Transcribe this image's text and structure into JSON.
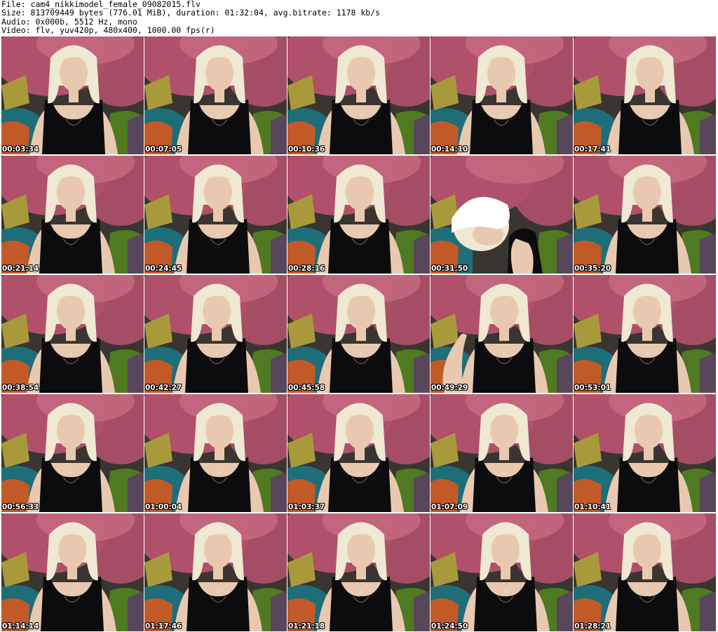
{
  "header": {
    "file_line": "File: cam4_nikkimodel_female_09082015.flv",
    "size_line": "Size: 813709449 bytes (776.01 MiB), duration: 01:32:04, avg.bitrate: 1178 kb/s",
    "audio_line": "Audio: 0x000b, 5512 Hz, mono",
    "video_line": "Video: flv, yuv420p, 480x400, 1000.00 fps(r)"
  },
  "colors": {
    "background": "#ffffff",
    "flower_pink": "#b0506a",
    "wall_dark": "#3a3530",
    "teal_fabric": "#1e6e7a",
    "green_fabric": "#4f7a22",
    "gold_pillow": "#a89a3a",
    "orange_pillow": "#c25a28",
    "hair_blonde": "#efe8d2",
    "skin": "#e8c9b0",
    "dress_black": "#0c0c0e"
  },
  "thumbnails": [
    {
      "timestamp": "00:03:34"
    },
    {
      "timestamp": "00:07:05"
    },
    {
      "timestamp": "00:10:36"
    },
    {
      "timestamp": "00:14:10"
    },
    {
      "timestamp": "00:17:41"
    },
    {
      "timestamp": "00:21:14"
    },
    {
      "timestamp": "00:24:45"
    },
    {
      "timestamp": "00:28:16"
    },
    {
      "timestamp": "00:31:50"
    },
    {
      "timestamp": "00:35:20"
    },
    {
      "timestamp": "00:38:54"
    },
    {
      "timestamp": "00:42:27"
    },
    {
      "timestamp": "00:45:58"
    },
    {
      "timestamp": "00:49:29"
    },
    {
      "timestamp": "00:53:01"
    },
    {
      "timestamp": "00:56:33"
    },
    {
      "timestamp": "01:00:04"
    },
    {
      "timestamp": "01:03:37"
    },
    {
      "timestamp": "01:07:09"
    },
    {
      "timestamp": "01:10:41"
    },
    {
      "timestamp": "01:14:14"
    },
    {
      "timestamp": "01:17:46"
    },
    {
      "timestamp": "01:21:18"
    },
    {
      "timestamp": "01:24:50"
    },
    {
      "timestamp": "01:28:21"
    }
  ]
}
